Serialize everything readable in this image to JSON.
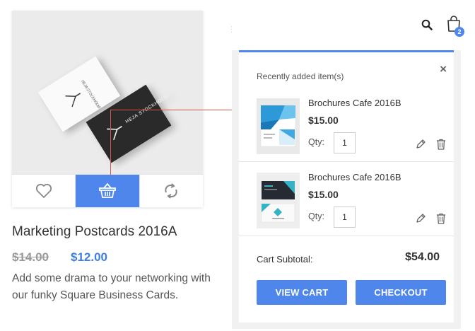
{
  "product": {
    "title": "Marketing Postcards 2016A",
    "old_price": "$14.00",
    "new_price": "$12.00",
    "description": "Add some drama to your networking with our funky Square Business Cards.",
    "card_text": "HEJA STOCKHOLM!",
    "actions": [
      "heart-icon",
      "basket-icon",
      "refresh-icon"
    ]
  },
  "header": {
    "cart_count": "2",
    "icons": [
      "search-icon",
      "shopping-bag-icon"
    ]
  },
  "cart": {
    "heading": "Recently added item(s)",
    "close_glyph": "×",
    "items": [
      {
        "name": "Brochures Cafe 2016B",
        "price": "$15.00",
        "qty_label": "Qty:",
        "qty": "1"
      },
      {
        "name": "Brochures Cafe 2016B",
        "price": "$15.00",
        "qty_label": "Qty:",
        "qty": "1"
      }
    ],
    "subtotal_label": "Cart Subtotal:",
    "subtotal_value": "$54.00",
    "view_cart_label": "VIEW CART",
    "checkout_label": "CHECKOUT"
  },
  "colors": {
    "accent": "#4f86ec",
    "connector": "#d9534f"
  }
}
